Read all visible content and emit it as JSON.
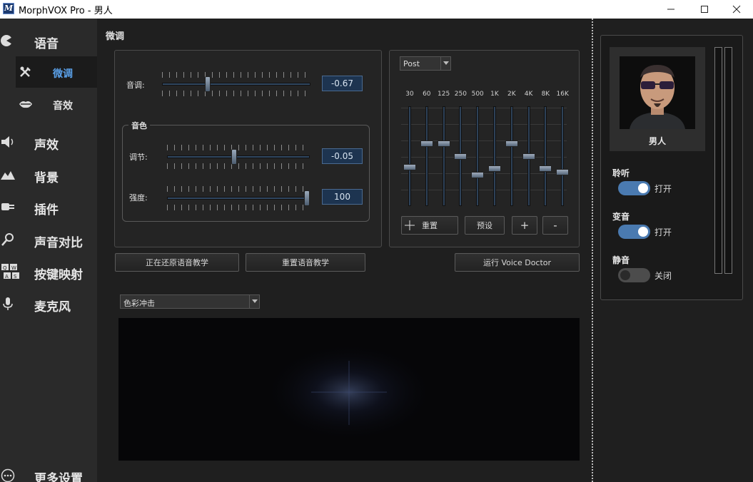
{
  "window": {
    "title": "MorphVOX Pro - 男人",
    "logo_letter": "M"
  },
  "sidebar": {
    "items": [
      {
        "id": "voice",
        "label": "语音",
        "icon": "voice-icon"
      },
      {
        "id": "sound-effects",
        "label": "声效",
        "icon": "speaker-icon"
      },
      {
        "id": "background",
        "label": "背景",
        "icon": "mountain-icon"
      },
      {
        "id": "plugins",
        "label": "插件",
        "icon": "plug-icon"
      },
      {
        "id": "voice-compare",
        "label": "声音对比",
        "icon": "magnifier-icon"
      },
      {
        "id": "key-mapping",
        "label": "按键映射",
        "icon": "keyboard-icon"
      },
      {
        "id": "microphone",
        "label": "麦克风",
        "icon": "microphone-icon"
      },
      {
        "id": "more-settings",
        "label": "更多设置",
        "icon": "more-icon"
      }
    ],
    "subitems": [
      {
        "id": "tweak",
        "label": "微调",
        "icon": "tools-icon",
        "active": true
      },
      {
        "id": "effects",
        "label": "音效",
        "icon": "lips-icon",
        "active": false
      }
    ]
  },
  "main": {
    "section_title": "微调",
    "pitch": {
      "label": "音调:",
      "value": "-0.67",
      "level": 0.3
    },
    "timbre": {
      "title": "音色",
      "adjust": {
        "label": "调节:",
        "value": "-0.05",
        "level": 0.47
      },
      "strength": {
        "label": "强度:",
        "value": "100",
        "level": 1.0
      }
    },
    "buttons": {
      "restoring": "正在还原语音教学",
      "reset_training": "重置语音教学",
      "voice_doctor": "运行 Voice Doctor"
    },
    "eq": {
      "mode": "Post",
      "bands": [
        {
          "freq": "30",
          "level": 0.62
        },
        {
          "freq": "60",
          "level": 0.37
        },
        {
          "freq": "125",
          "level": 0.37
        },
        {
          "freq": "250",
          "level": 0.5
        },
        {
          "freq": "500",
          "level": 0.7
        },
        {
          "freq": "1K",
          "level": 0.63
        },
        {
          "freq": "2K",
          "level": 0.37
        },
        {
          "freq": "4K",
          "level": 0.5
        },
        {
          "freq": "8K",
          "level": 0.63
        },
        {
          "freq": "16K",
          "level": 0.67
        }
      ],
      "reset_label": "重置",
      "preset_label": "预设",
      "plus_label": "+",
      "minus_label": "-"
    },
    "visualizer": {
      "mode": "色彩冲击"
    }
  },
  "right": {
    "voice_name": "男人",
    "listen": {
      "label": "聆听",
      "state": "打开",
      "on": true
    },
    "morph": {
      "label": "变音",
      "state": "打开",
      "on": true
    },
    "mute": {
      "label": "静音",
      "state": "关闭",
      "on": false
    }
  }
}
